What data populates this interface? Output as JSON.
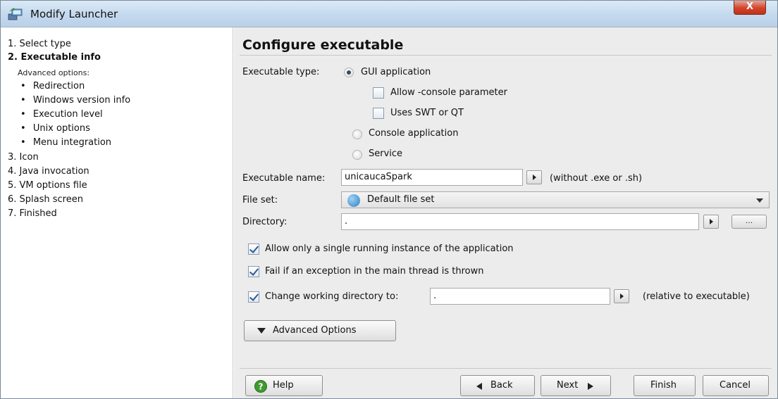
{
  "window": {
    "title": "Modify Launcher",
    "close_label": "X"
  },
  "nav": {
    "steps": [
      {
        "label": "1. Select type"
      },
      {
        "label": "2. Executable info"
      }
    ],
    "advanced_heading": "Advanced options:",
    "advanced_items": [
      {
        "label": "Redirection"
      },
      {
        "label": "Windows version info"
      },
      {
        "label": "Execution level"
      },
      {
        "label": "Unix options"
      },
      {
        "label": "Menu integration"
      }
    ],
    "later_steps": [
      {
        "label": "3. Icon"
      },
      {
        "label": "4. Java invocation"
      },
      {
        "label": "5. VM options file"
      },
      {
        "label": "6. Splash screen"
      },
      {
        "label": "7. Finished"
      }
    ],
    "bullet": "•"
  },
  "content": {
    "title": "Configure executable",
    "executable_type": {
      "label": "Executable type:",
      "options": {
        "gui": "GUI application",
        "console": "Console application",
        "service": "Service"
      },
      "selected": "gui",
      "gui_checks": {
        "allow_console": {
          "label": "Allow -console parameter",
          "checked": false
        },
        "uses_swt": {
          "label": "Uses SWT or QT",
          "checked": false
        }
      }
    },
    "executable_name": {
      "label": "Executable name:",
      "value": "unicaucaSpark",
      "hint": "(without .exe or .sh)"
    },
    "file_set": {
      "label": "File set:",
      "value": "Default file set"
    },
    "directory": {
      "label": "Directory:",
      "value": ".",
      "browse_label": "..."
    },
    "options": {
      "single_instance": {
        "label": "Allow only a single running instance of the application",
        "checked": true
      },
      "fail_exception": {
        "label": "Fail if an exception in the main thread is thrown",
        "checked": true
      },
      "change_dir": {
        "label": "Change working directory to:",
        "checked": true,
        "value": ".",
        "hint": "(relative to executable)"
      }
    },
    "advanced_button": "Advanced Options"
  },
  "footer": {
    "help": "Help",
    "back": "Back",
    "next": "Next",
    "finish": "Finish",
    "cancel": "Cancel"
  },
  "colors": {
    "title_bar": "#c4d9ee",
    "close_button": "#d2432a",
    "content_bg": "#ececec",
    "help_icon": "#3f9a2f"
  }
}
